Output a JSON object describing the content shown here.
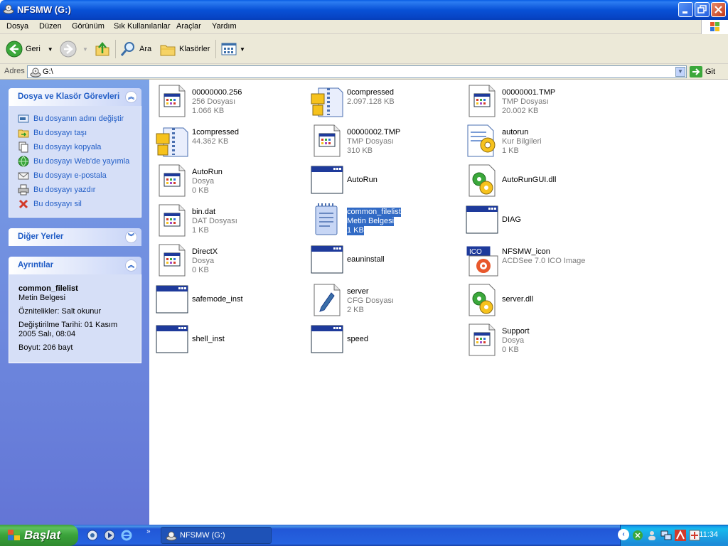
{
  "window": {
    "title": "NFSMW (G:)"
  },
  "menu": [
    "Dosya",
    "Düzen",
    "Görünüm",
    "Sık Kullanılanlar",
    "Araçlar",
    "Yardım"
  ],
  "toolbar": {
    "back_label": "Geri",
    "search_label": "Ara",
    "folders_label": "Klasörler"
  },
  "address": {
    "label": "Adres",
    "value": "G:\\",
    "go_label": "Git"
  },
  "sidebar": {
    "tasks_title": "Dosya ve Klasör Görevleri",
    "tasks": [
      {
        "label": "Bu dosyanın adını değiştir",
        "icon": "rename-icon"
      },
      {
        "label": "Bu dosyayı taşı",
        "icon": "move-icon"
      },
      {
        "label": "Bu dosyayı kopyala",
        "icon": "copy-icon"
      },
      {
        "label": "Bu dosyayı Web'de yayımla",
        "icon": "web-publish-icon"
      },
      {
        "label": "Bu dosyayı e-postala",
        "icon": "email-icon"
      },
      {
        "label": "Bu dosyayı yazdır",
        "icon": "print-icon"
      },
      {
        "label": "Bu dosyayı sil",
        "icon": "delete-icon"
      }
    ],
    "other_places_title": "Diğer Yerler",
    "details_title": "Ayrıntılar",
    "details": {
      "name": "common_filelist",
      "type": "Metin Belgesi",
      "attributes": "Öznitelikler: Salt okunur",
      "modified": "Değiştirilme Tarihi: 01 Kasım 2005 Salı, 08:04",
      "size": "Boyut: 206 bayt"
    }
  },
  "files": [
    {
      "name": "00000000.256",
      "type": "256 Dosyası",
      "size": "1.066 KB",
      "icon": "generic-file-icon"
    },
    {
      "name": "0compressed",
      "type": "",
      "size": "2.097.128 KB",
      "icon": "compressed-folder-icon"
    },
    {
      "name": "00000001.TMP",
      "type": "TMP Dosyası",
      "size": "20.002 KB",
      "icon": "generic-file-icon"
    },
    {
      "name": "1compressed",
      "type": "",
      "size": "44.362 KB",
      "icon": "compressed-folder-icon"
    },
    {
      "name": "00000002.TMP",
      "type": "TMP Dosyası",
      "size": "310 KB",
      "icon": "generic-file-icon"
    },
    {
      "name": "autorun",
      "type": "Kur Bilgileri",
      "size": "1 KB",
      "icon": "setup-info-icon"
    },
    {
      "name": "AutoRun",
      "type": "Dosya",
      "size": "0 KB",
      "icon": "generic-file-icon"
    },
    {
      "name": "AutoRun",
      "type": "",
      "size": "",
      "icon": "application-icon"
    },
    {
      "name": "AutoRunGUI.dll",
      "type": "",
      "size": "",
      "icon": "dll-icon"
    },
    {
      "name": "bin.dat",
      "type": "DAT Dosyası",
      "size": "1 KB",
      "icon": "generic-file-icon"
    },
    {
      "name": "common_filelist",
      "type": "Metin Belgesi",
      "size": "1 KB",
      "icon": "text-document-icon",
      "selected": true
    },
    {
      "name": "DIAG",
      "type": "",
      "size": "",
      "icon": "application-icon"
    },
    {
      "name": "DirectX",
      "type": "Dosya",
      "size": "0 KB",
      "icon": "generic-file-icon"
    },
    {
      "name": "eauninstall",
      "type": "",
      "size": "",
      "icon": "application-icon"
    },
    {
      "name": "NFSMW_icon",
      "type": "ACDSee 7.0 ICO Image",
      "size": "",
      "icon": "ico-image-icon"
    },
    {
      "name": "safemode_inst",
      "type": "",
      "size": "",
      "icon": "application-icon"
    },
    {
      "name": "server",
      "type": "CFG Dosyası",
      "size": "2 KB",
      "icon": "config-file-icon"
    },
    {
      "name": "server.dll",
      "type": "",
      "size": "",
      "icon": "dll-icon"
    },
    {
      "name": "shell_inst",
      "type": "",
      "size": "",
      "icon": "application-icon"
    },
    {
      "name": "speed",
      "type": "",
      "size": "",
      "icon": "application-icon"
    },
    {
      "name": "Support",
      "type": "Dosya",
      "size": "0 KB",
      "icon": "generic-file-icon"
    }
  ],
  "taskbar": {
    "start_label": "Başlat",
    "window_label": "NFSMW (G:)",
    "clock": "11:34"
  }
}
